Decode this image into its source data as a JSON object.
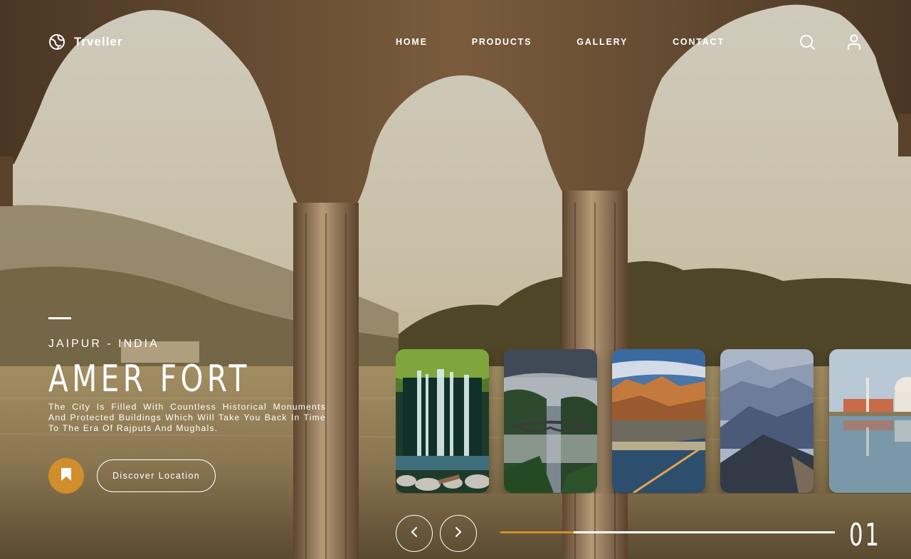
{
  "brand": {
    "name": "Trveller",
    "logo_icon": "globe-icon"
  },
  "nav": {
    "items": [
      {
        "label": "HOME"
      },
      {
        "label": "PRODUCTS"
      },
      {
        "label": "GALLERY"
      },
      {
        "label": "CONTACT"
      }
    ],
    "icons": [
      "search-icon",
      "user-icon"
    ]
  },
  "hero": {
    "location": "JAIPUR - INDIA",
    "title": "AMER FORT",
    "description": "The City Is Filled With Countless Historical Monuments And Protected Buildings Which Will Take You Back In Time To The Era Of Rajputs And Mughals.",
    "discover_label": "Discover  Location",
    "bookmark_icon": "bookmark-icon"
  },
  "cards": [
    {
      "name": "waterfall"
    },
    {
      "name": "misty-bridge"
    },
    {
      "name": "desert-road"
    },
    {
      "name": "blue-mountains"
    },
    {
      "name": "taj-mahal"
    }
  ],
  "slider": {
    "current": "01",
    "progress": 0.22,
    "prev_icon": "chevron-left-icon",
    "next_icon": "chevron-right-icon"
  },
  "colors": {
    "accent": "#d08e2c",
    "text": "#ffffff"
  }
}
